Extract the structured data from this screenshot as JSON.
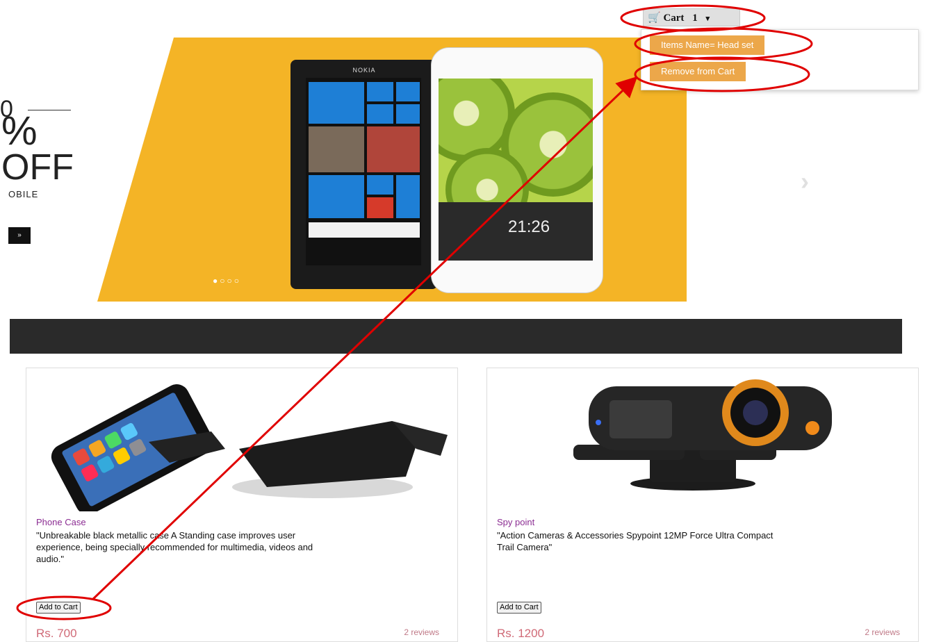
{
  "cart": {
    "label": "Cart",
    "count": "1",
    "caret": "▾",
    "menu": {
      "item_name": "Items Name= Head set",
      "remove": "Remove from Cart"
    }
  },
  "banner": {
    "promo_top": "0",
    "percent": "%",
    "off": "OFF",
    "subtitle": "OBILE",
    "button": "»",
    "brand": "NOKIA",
    "clock": "21:26",
    "dots": "●○○○",
    "next": "›"
  },
  "products": [
    {
      "name": "Phone Case",
      "description": "\"Unbreakable black metallic case A Standing case improves user experience, being specially recommended for multimedia, videos and audio.\"",
      "button": "Add to Cart",
      "price": "Rs. 700",
      "reviews": "2 reviews"
    },
    {
      "name": "Spy point",
      "description": "\"Action Cameras & Accessories Spypoint 12MP Force Ultra Compact Trail Camera\"",
      "button": "Add to Cart",
      "price": "Rs. 1200",
      "reviews": "2 reviews"
    }
  ],
  "colors": {
    "accent_orange": "#eca74a",
    "banner_yellow": "#f4b426",
    "annotation_red": "#e00000",
    "product_name": "#8b2c92",
    "price": "#d06a77"
  }
}
